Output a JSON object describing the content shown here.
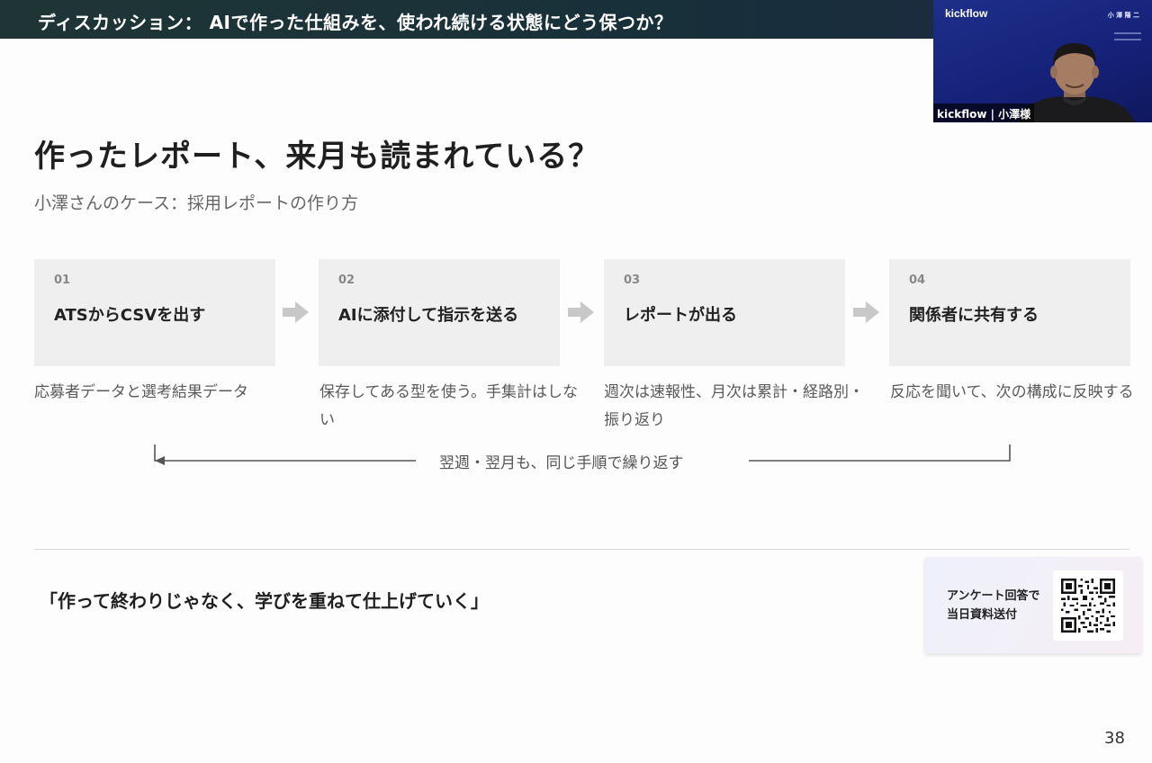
{
  "header": {
    "title": "ディスカッション： AIで作った仕組みを、使われ続ける状態にどう保つか？"
  },
  "video": {
    "logo": "kickflow",
    "name": "小 澤 陽 二",
    "caption": "kickflow | 小澤様"
  },
  "slide": {
    "title": "作ったレポート、来月も読まれている？",
    "subtitle": "小澤さんのケース：採用レポートの作り方",
    "steps": [
      {
        "num": "01",
        "label": "ATSからCSVを出す",
        "desc": "応募者データと選考結果データ"
      },
      {
        "num": "02",
        "label": "AIに添付して指示を送る",
        "desc": "保存してある型を使う。手集計はしない"
      },
      {
        "num": "03",
        "label": "レポートが出る",
        "desc": "週次は速報性、月次は累計・経路別・振り返り"
      },
      {
        "num": "04",
        "label": "関係者に共有する",
        "desc": "反応を聞いて、次の構成に反映する"
      }
    ],
    "loop_text": "翌週・翌月も、同じ手順で繰り返す",
    "quote": "「作って終わりじゃなく、学びを重ねて仕上げていく」",
    "page_number": "38"
  },
  "survey": {
    "line1": "アンケート回答で",
    "line2": "当日資料送付"
  },
  "colors": {
    "topbar": "#1f3535",
    "step_box": "#efefef",
    "arrow": "#c8c8c8",
    "video_bg": "#1a2a82"
  }
}
